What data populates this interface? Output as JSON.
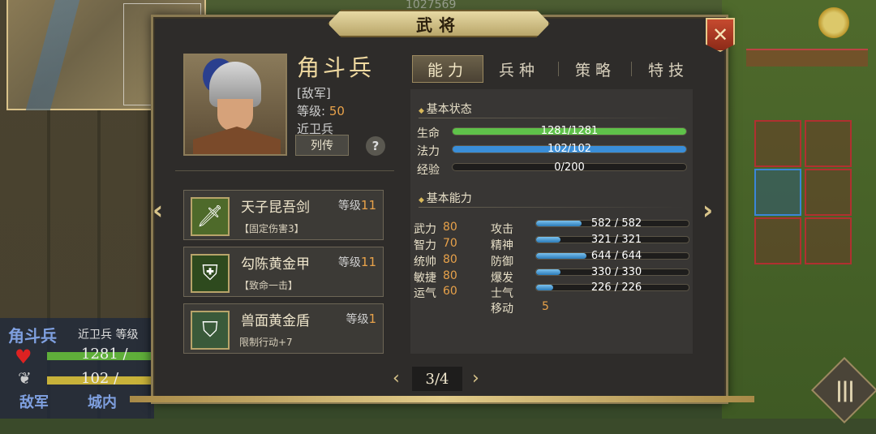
{
  "background": {
    "top_score": "1027569"
  },
  "hud": {
    "name": "角斗兵",
    "class": "近卫兵 等级",
    "hp": "1281 /",
    "mp": "102 /",
    "side": "敌军",
    "location": "城内"
  },
  "dialog": {
    "title": "武将",
    "close_icon": "close-x-icon"
  },
  "unit": {
    "name": "角斗兵",
    "side": "[敌军]",
    "level_label": "等级:",
    "level": "50",
    "class": "近卫兵",
    "bio_label": "列传",
    "help_label": "?"
  },
  "equipment": [
    {
      "name": "天子昆吾剑",
      "level_label": "等级",
      "level": "11",
      "desc": "【固定伤害3】",
      "icon": "sword-icon"
    },
    {
      "name": "勾陈黄金甲",
      "level_label": "等级",
      "level": "11",
      "desc": "【致命一击】",
      "icon": "armor-icon"
    },
    {
      "name": "兽面黄金盾",
      "level_label": "等级",
      "level": "1",
      "desc": "限制行动+7",
      "icon": "shield-icon"
    }
  ],
  "tabs": [
    {
      "label": "能力",
      "active": true
    },
    {
      "label": "兵种",
      "active": false
    },
    {
      "label": "策略",
      "active": false
    },
    {
      "label": "特技",
      "active": false
    }
  ],
  "basic_status": {
    "title": "基本状态",
    "bars": [
      {
        "label": "生命",
        "text": "1281/1281",
        "fraction": 1.0,
        "color": "#5fc24a"
      },
      {
        "label": "法力",
        "text": "102/102",
        "fraction": 1.0,
        "color": "#3a8ed8"
      },
      {
        "label": "经验",
        "text": "0/200",
        "fraction": 0.0,
        "color": "#c8a23a"
      }
    ]
  },
  "basic_ability": {
    "title": "基本能力",
    "attributes": [
      {
        "label": "武力",
        "value": "80"
      },
      {
        "label": "智力",
        "value": "70"
      },
      {
        "label": "统帅",
        "value": "80"
      },
      {
        "label": "敏捷",
        "value": "80"
      },
      {
        "label": "运气",
        "value": "60"
      }
    ],
    "stats": [
      {
        "label": "攻击",
        "text": "582 / 582",
        "fraction": 0.3
      },
      {
        "label": "精神",
        "text": "321 / 321",
        "fraction": 0.16
      },
      {
        "label": "防御",
        "text": "644 / 644",
        "fraction": 0.33
      },
      {
        "label": "爆发",
        "text": "330 / 330",
        "fraction": 0.16
      },
      {
        "label": "士气",
        "text": "226 / 226",
        "fraction": 0.11
      }
    ],
    "move_label": "移动",
    "move": "5"
  },
  "pager": {
    "text": "3/4"
  },
  "colors": {
    "accent_gold": "#d8c48a",
    "value_orange": "#e8a24a",
    "panel_bg": "#2e2c2a"
  }
}
